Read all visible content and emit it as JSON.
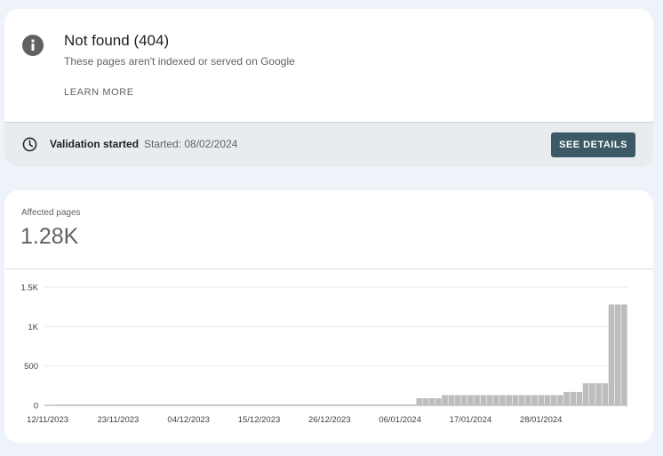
{
  "issue": {
    "title": "Not found (404)",
    "subtitle": "These pages aren't indexed or served on Google",
    "learn_more": "LEARN MORE",
    "icon": "info-icon"
  },
  "validation": {
    "status": "Validation started",
    "started": "Started: 08/02/2024",
    "button": "SEE DETAILS",
    "icon": "clock-icon"
  },
  "summary": {
    "label": "Affected pages",
    "value": "1.28K"
  },
  "colors": {
    "bar": "#bdbdbd",
    "button": "#3c5a66",
    "status_bar": "#e9ecef"
  },
  "chart_data": {
    "type": "bar",
    "ylim": [
      0,
      1500
    ],
    "y_ticks": [
      0,
      500,
      1000,
      1500
    ],
    "y_tick_labels": [
      "0",
      "500",
      "1K",
      "1.5K"
    ],
    "x_tick_labels": [
      "12/11/2023",
      "23/11/2023",
      "04/12/2023",
      "15/12/2023",
      "26/12/2023",
      "06/01/2024",
      "17/01/2024",
      "28/01/2024"
    ],
    "x_tick_indices": [
      0,
      11,
      22,
      33,
      44,
      55,
      66,
      77
    ],
    "values": [
      0,
      10,
      10,
      10,
      10,
      10,
      10,
      10,
      10,
      10,
      10,
      10,
      10,
      10,
      10,
      10,
      10,
      10,
      10,
      10,
      10,
      10,
      10,
      10,
      10,
      10,
      10,
      10,
      10,
      10,
      10,
      10,
      10,
      10,
      10,
      10,
      10,
      10,
      10,
      10,
      10,
      10,
      10,
      10,
      10,
      10,
      10,
      10,
      10,
      10,
      10,
      10,
      10,
      10,
      10,
      10,
      10,
      10,
      90,
      90,
      90,
      90,
      130,
      130,
      130,
      130,
      130,
      130,
      130,
      130,
      130,
      130,
      130,
      130,
      130,
      130,
      130,
      130,
      130,
      130,
      130,
      170,
      170,
      170,
      280,
      280,
      280,
      280,
      1280,
      1280,
      1280
    ],
    "grid": true
  }
}
